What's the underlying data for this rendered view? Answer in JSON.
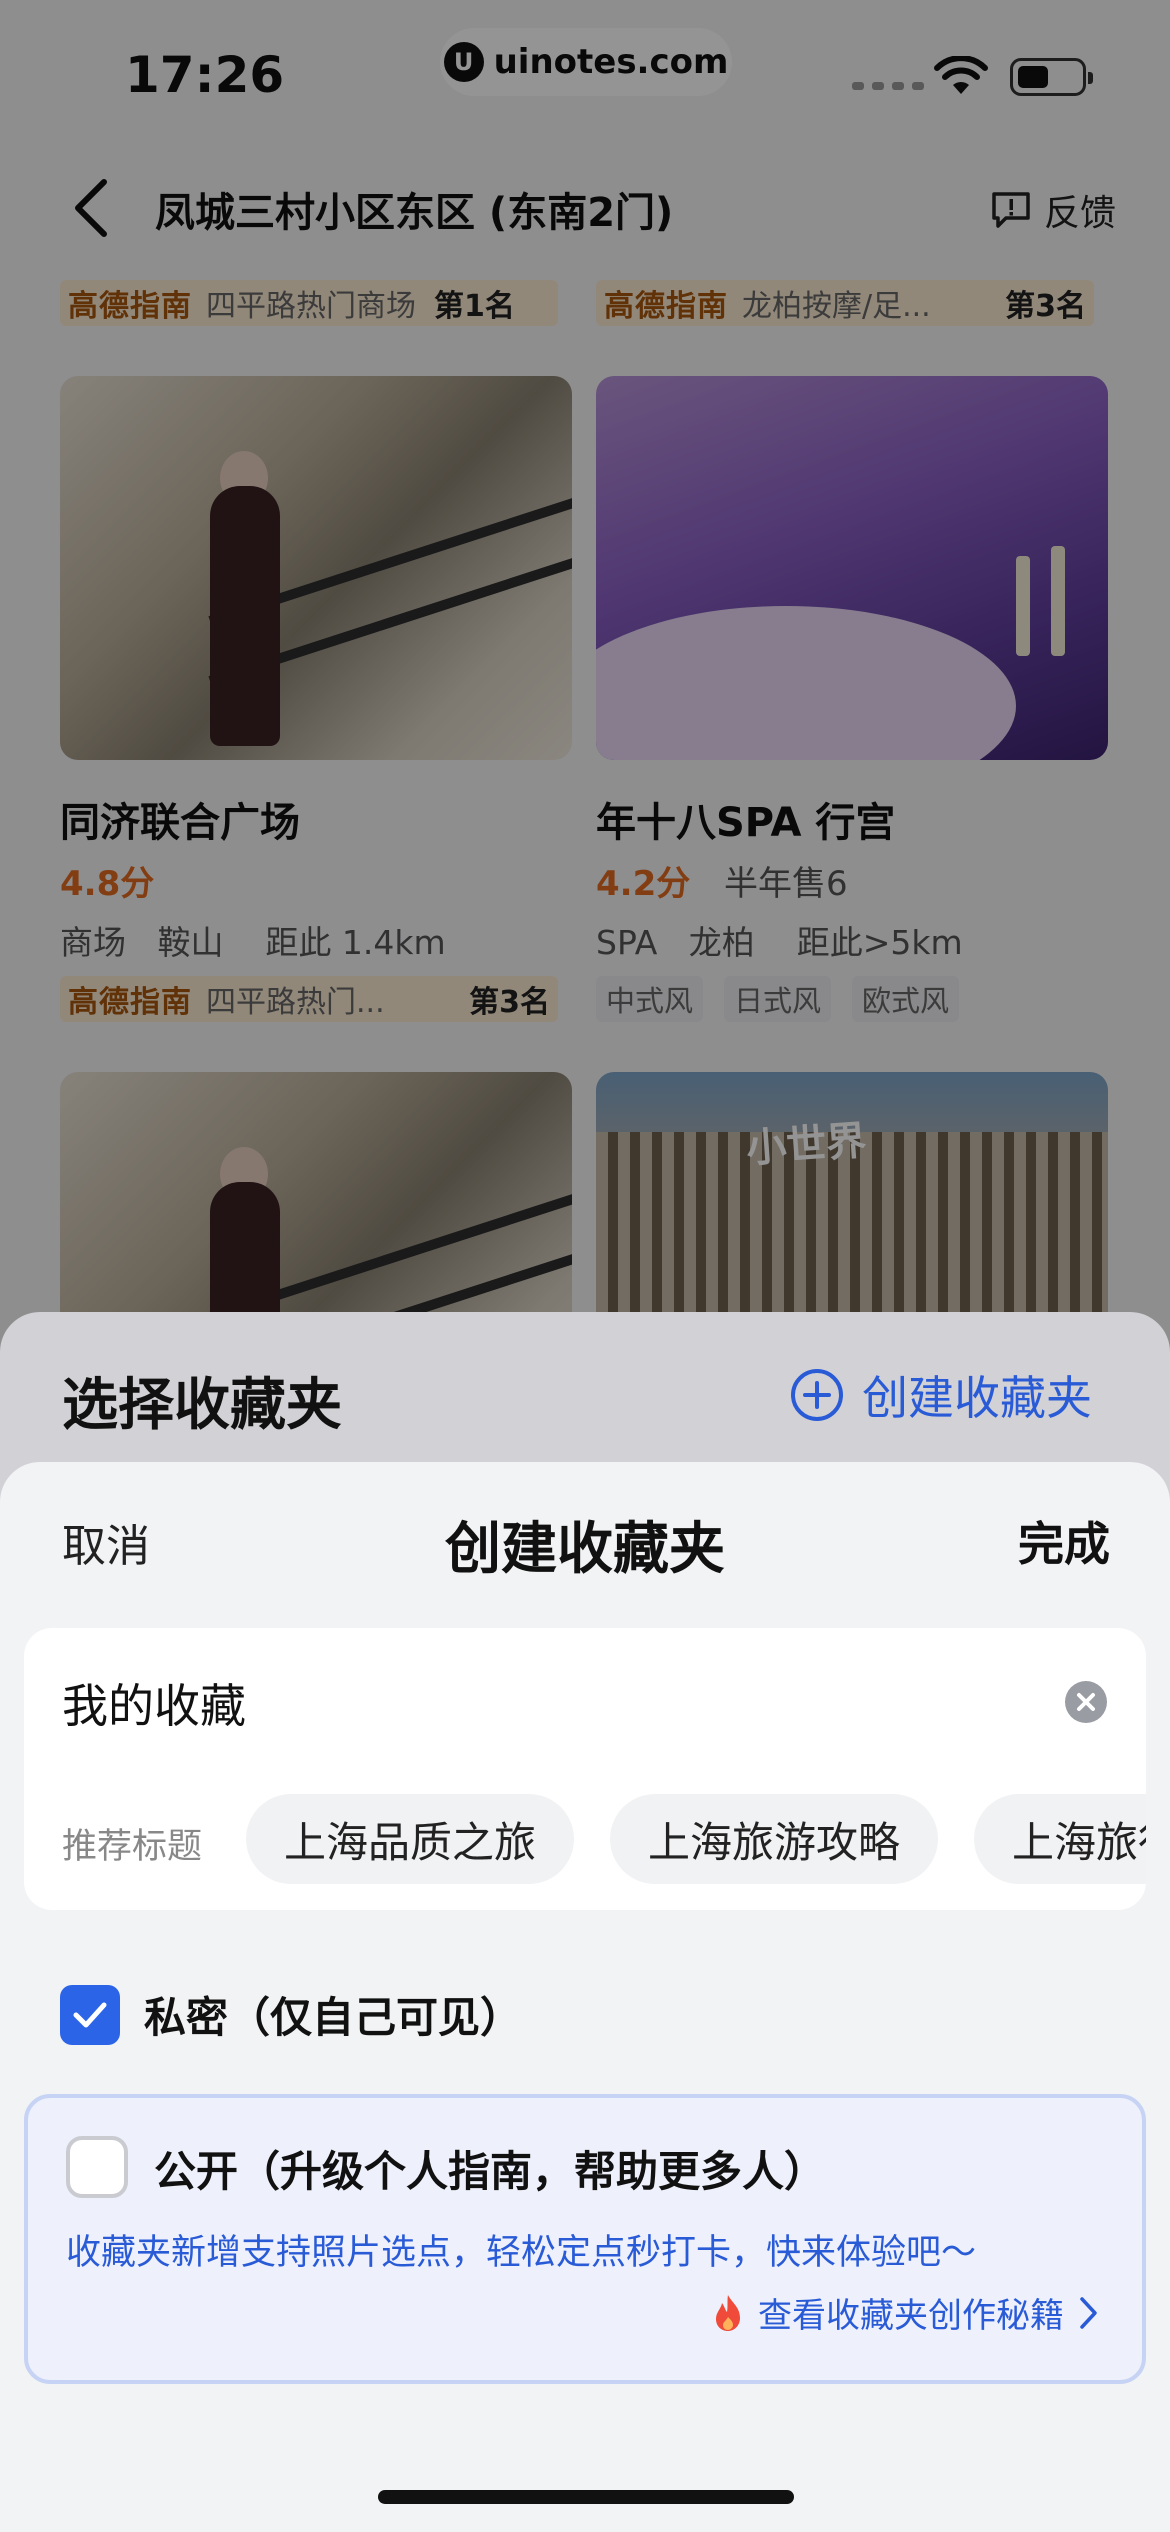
{
  "status_bar": {
    "time": "17:26",
    "watermark": "uinotes.com"
  },
  "nav": {
    "title": "凤城三村小区东区 (东南2门)",
    "feedback_label": "反馈"
  },
  "top_tags": [
    {
      "brand": "高德指南",
      "text": "四平路热门商场",
      "rank": "第1名"
    },
    {
      "brand": "高德指南",
      "text": "龙柏按摩/足...",
      "rank": "第3名"
    }
  ],
  "cards": [
    {
      "name": "同济联合广场",
      "score": "4.8分",
      "meta": "商场   鞍山    距此 1.4km",
      "rank_tag": {
        "brand": "高德指南",
        "text": "四平路热门...",
        "rank": "第3名"
      }
    },
    {
      "name": "年十八SPA 行宫",
      "score": "4.2分",
      "sold": "半年售6",
      "meta": "SPA   龙柏    距此>5km",
      "styles": [
        "中式风",
        "日式风",
        "欧式风"
      ]
    },
    {
      "image_text": "小世界"
    }
  ],
  "back_sheet": {
    "title": "选择收藏夹",
    "create_label": "创建收藏夹"
  },
  "create_sheet": {
    "cancel_label": "取消",
    "title": "创建收藏夹",
    "done_label": "完成",
    "name_value": "我的收藏",
    "suggest_label": "推荐标题",
    "suggestions": [
      "上海品质之旅",
      "上海旅游攻略",
      "上海旅行"
    ],
    "private_label": "私密（仅自己可见）",
    "private_checked": true,
    "public_label": "公开（升级个人指南，帮助更多人）",
    "public_checked": false,
    "public_tip": "收藏夹新增支持照片选点，轻松定点秒打卡，快来体验吧～",
    "secret_link": "查看收藏夹创作秘籍"
  },
  "colors": {
    "accent": "#2c64e8",
    "link": "#2a5bd7",
    "score": "#e26a20",
    "rank_brand": "#a8560f"
  }
}
